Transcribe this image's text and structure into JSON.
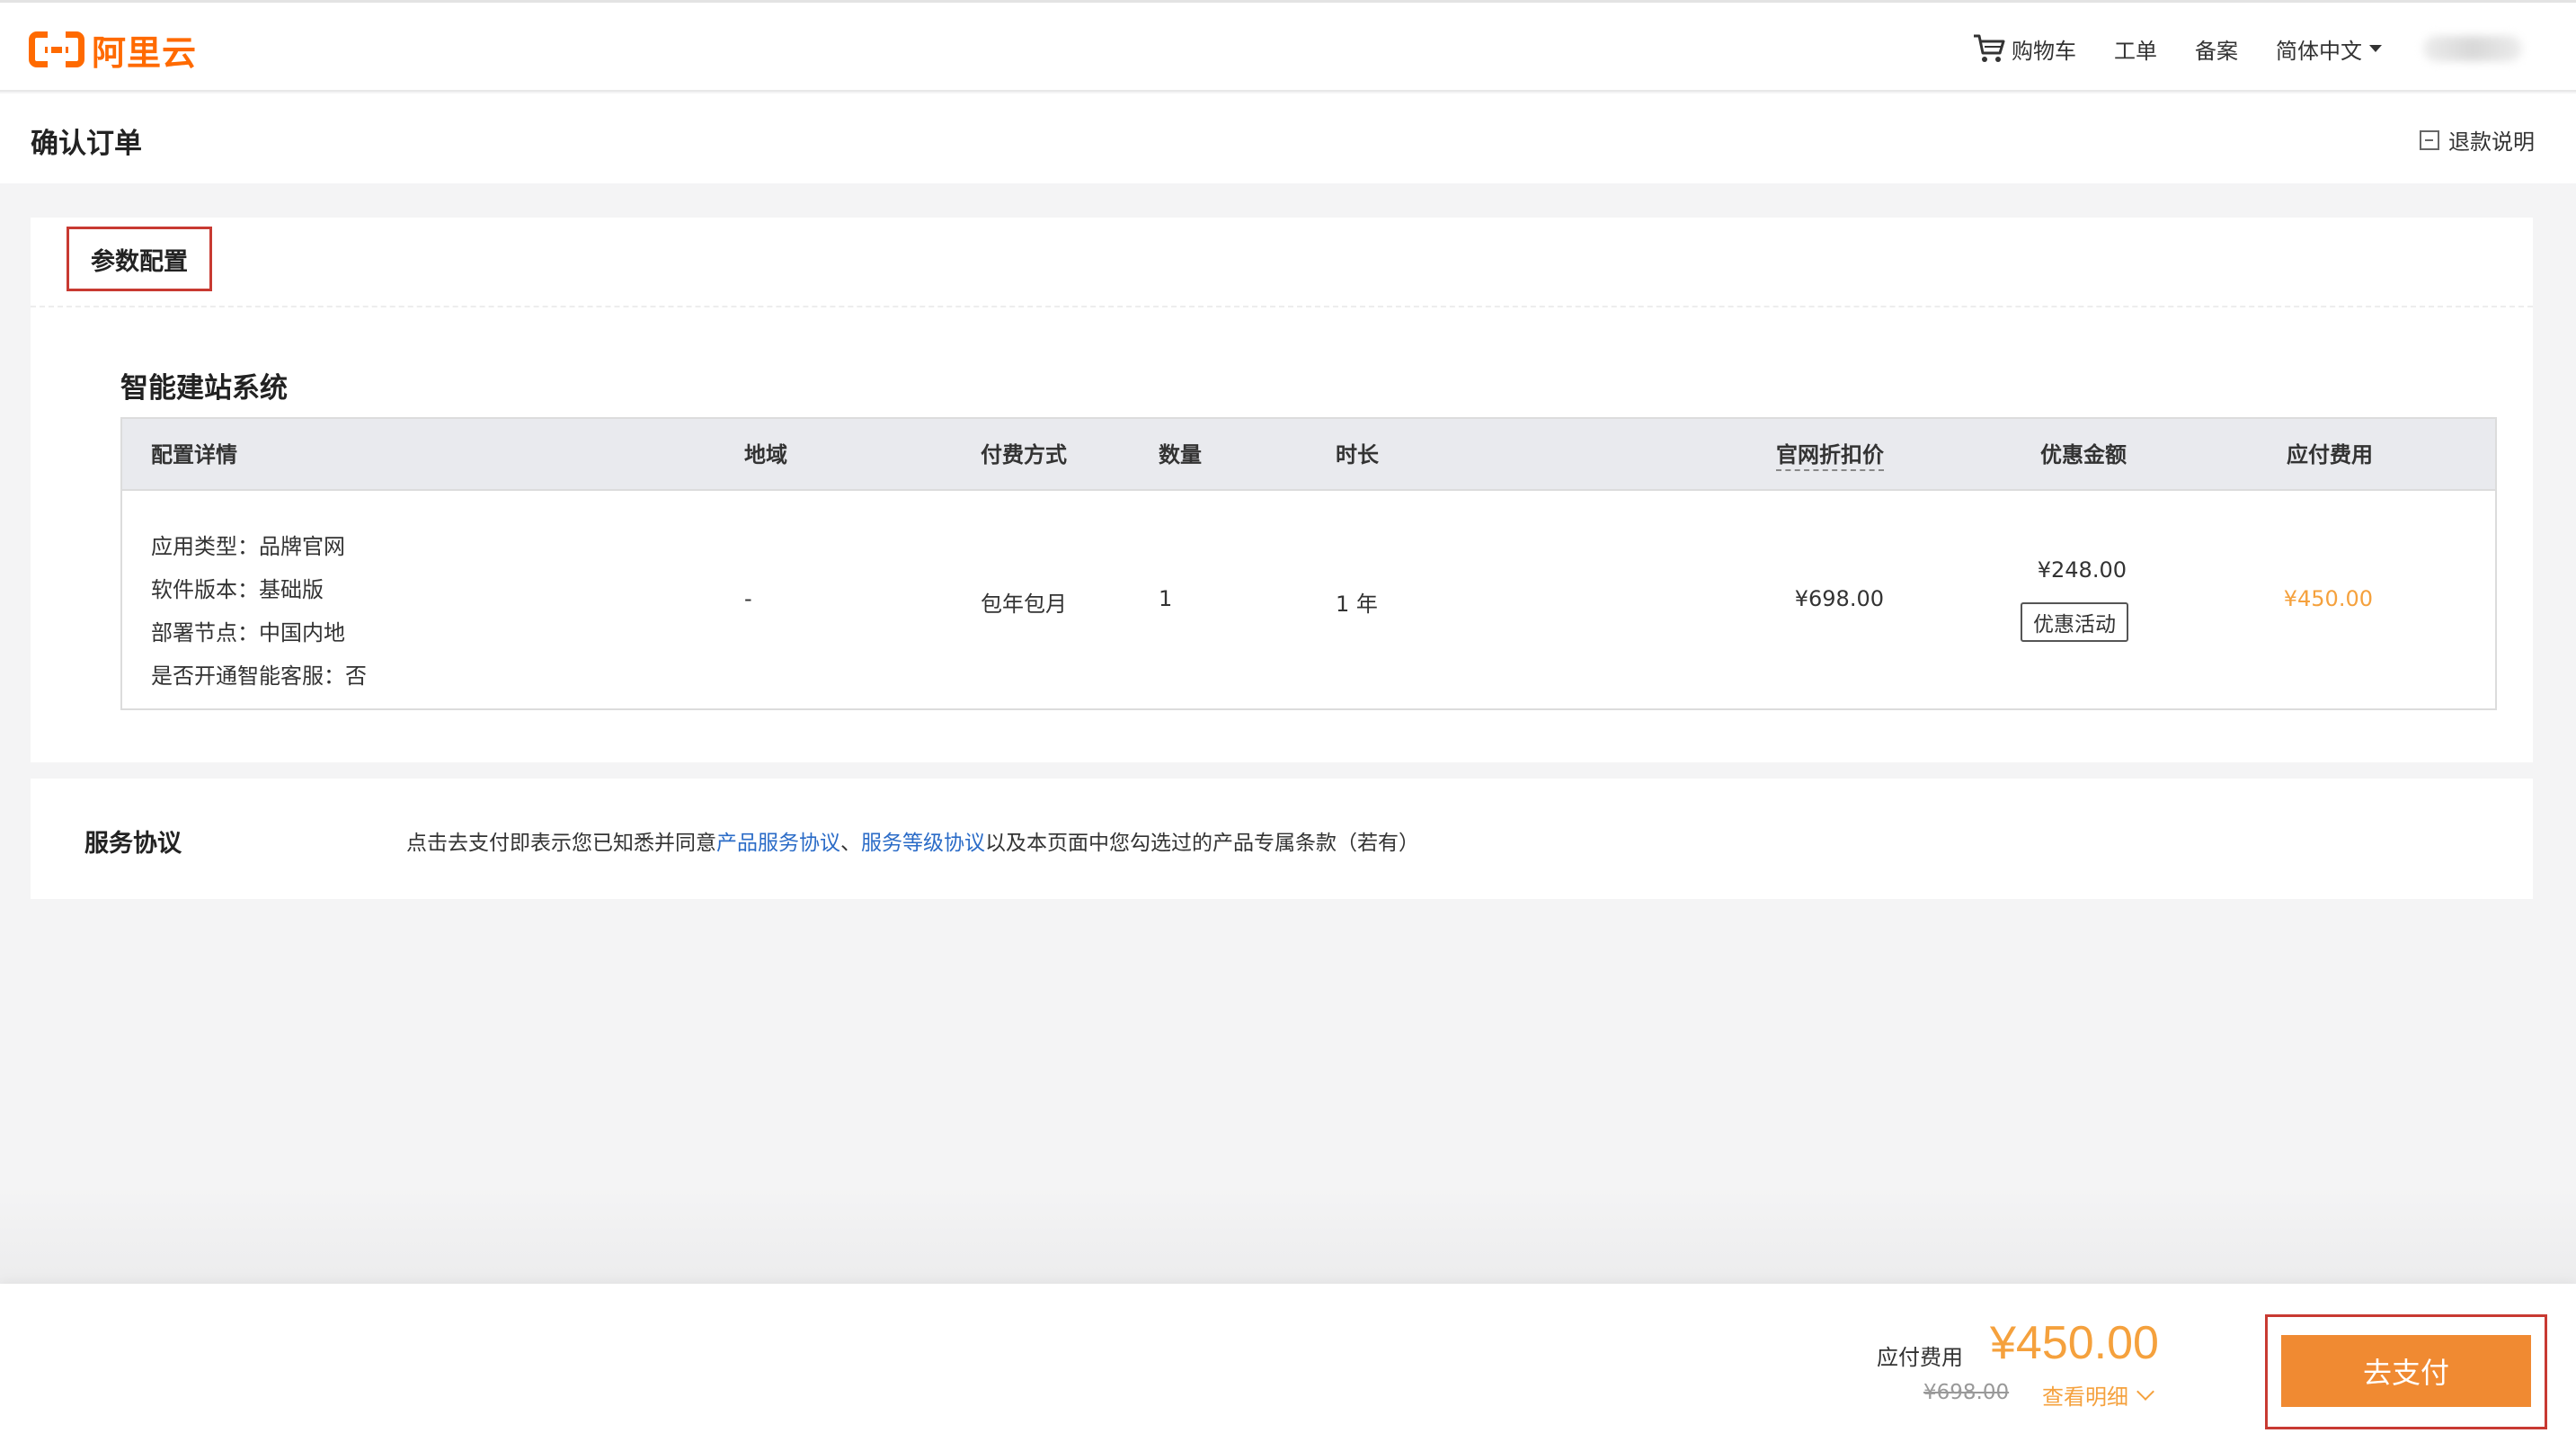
{
  "brand": {
    "logo_text": "阿里云",
    "accent": "#ff6a00"
  },
  "nav": {
    "cart": "购物车",
    "ticket": "工单",
    "filing": "备案",
    "language": "简体中文"
  },
  "header": {
    "title": "确认订单",
    "refund": "退款说明"
  },
  "config_section": {
    "tab": "参数配置",
    "product": "智能建站系统",
    "columns": [
      "配置详情",
      "地域",
      "付费方式",
      "数量",
      "时长",
      "官网折扣价",
      "优惠金额",
      "应付费用"
    ],
    "row": {
      "details": [
        "应用类型：品牌官网",
        "软件版本：基础版",
        "部署节点：中国内地",
        "是否开通智能客服：否"
      ],
      "region": "-",
      "billing": "包年包月",
      "quantity": "1",
      "duration": "1 年",
      "list_price": "¥698.00",
      "discount": "¥248.00",
      "discount_button": "优惠活动",
      "payable": "¥450.00"
    }
  },
  "agreement": {
    "title": "服务协议",
    "text_before": "点击去支付即表示您已知悉并同意",
    "link1": "产品服务协议",
    "separator": "、",
    "link2": "服务等级协议",
    "text_after": "以及本页面中您勾选过的产品专属条款（若有）"
  },
  "footer": {
    "total_label": "应付费用",
    "total": "¥450.00",
    "original": "¥698.00",
    "detail_link": "查看明细",
    "pay_button": "去支付",
    "accent": "#f08a32"
  }
}
